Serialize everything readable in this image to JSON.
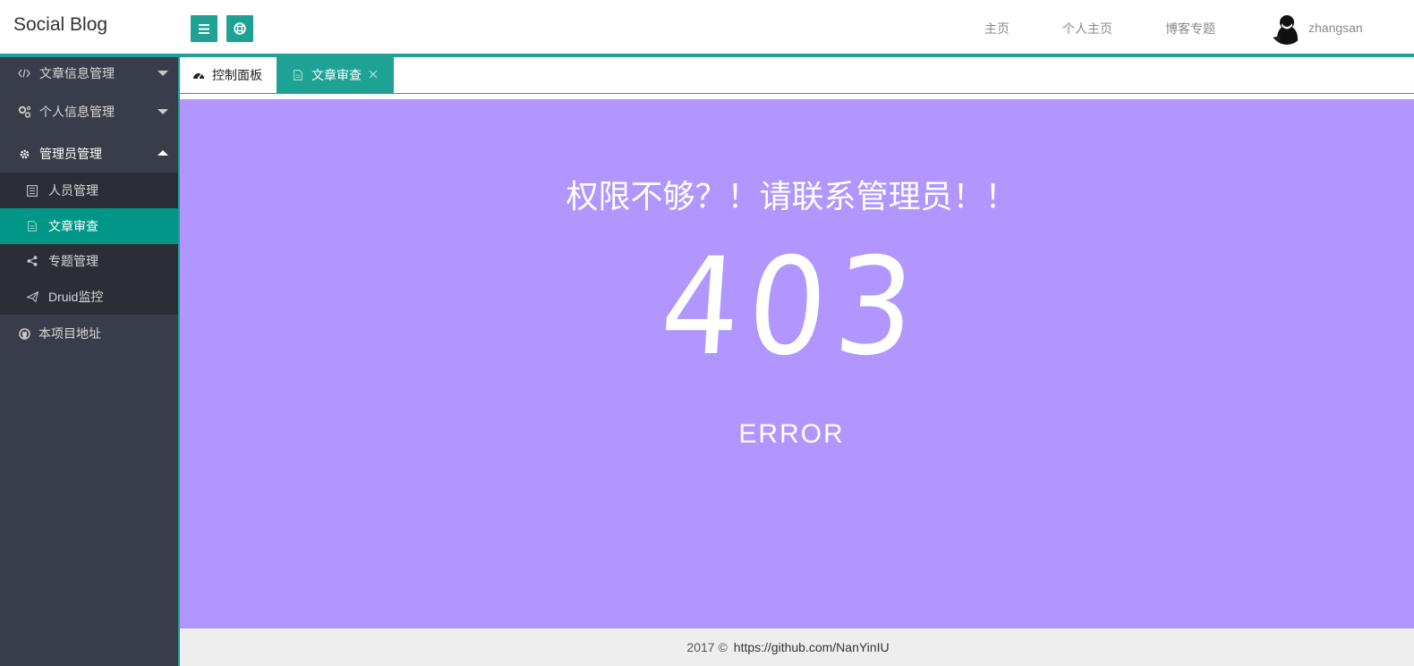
{
  "header": {
    "brand": "Social Blog",
    "menu_icon": "hamburger-menu-icon",
    "help_icon": "lifebuoy-icon",
    "nav": [
      "主页",
      "个人主页",
      "博客专题"
    ],
    "username": "zhangsan"
  },
  "sidebar": {
    "items": [
      {
        "label": "文章信息管理",
        "icon": "code-icon",
        "expanded": false
      },
      {
        "label": "个人信息管理",
        "icon": "gears-icon",
        "expanded": false
      },
      {
        "label": "管理员管理",
        "icon": "gear-icon",
        "expanded": true
      },
      {
        "label": "本项目地址",
        "icon": "github-icon"
      }
    ],
    "sub_items": [
      {
        "label": "人员管理",
        "icon": "list-icon"
      },
      {
        "label": "文章审查",
        "icon": "file-icon",
        "active": true
      },
      {
        "label": "专题管理",
        "icon": "share-icon"
      },
      {
        "label": "Druid监控",
        "icon": "paper-plane-icon"
      }
    ]
  },
  "tabs": [
    {
      "label": "控制面板",
      "icon": "dashboard-icon"
    },
    {
      "label": "文章审查",
      "icon": "file-icon",
      "active": true,
      "closable": true
    }
  ],
  "main": {
    "message": "权限不够？！请联系管理员！！",
    "code": "403",
    "error": "ERROR"
  },
  "footer": {
    "copyright": "2017 ©",
    "link": "https://github.com/NanYinIU"
  },
  "colors": {
    "accent": "#1ea295",
    "sidebar_bg": "#393d49",
    "submenu_bg": "#2b2e37",
    "active_item": "#009688",
    "main_bg": "#b196ff",
    "footer_bg": "#eeeeee"
  }
}
